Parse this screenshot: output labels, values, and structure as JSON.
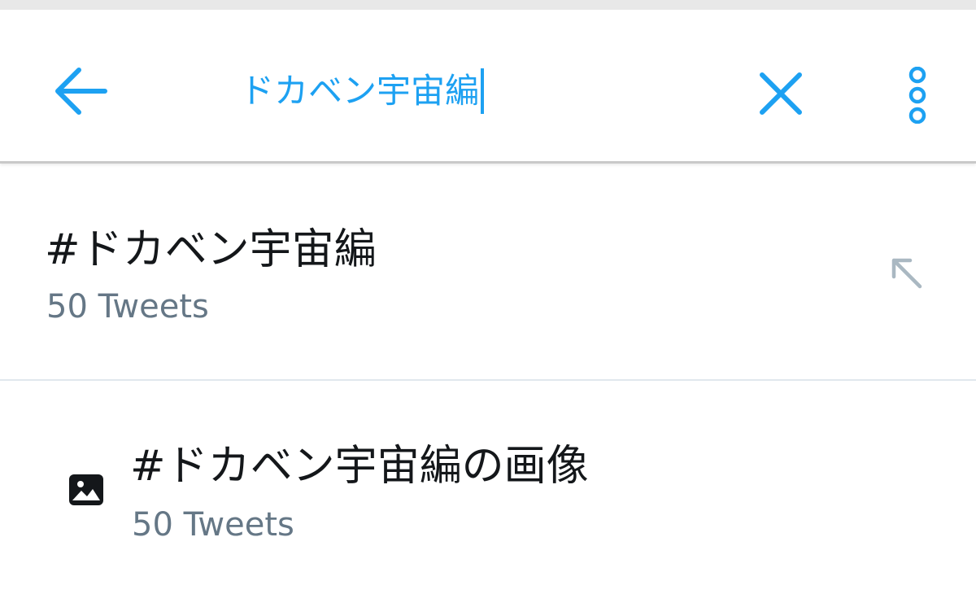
{
  "search": {
    "query": "ドカベン宇宙編"
  },
  "results": [
    {
      "title": "#ドカベン宇宙編",
      "subtitle": "50 Tweets"
    },
    {
      "title": "#ドカベン宇宙編の画像",
      "subtitle": "50 Tweets"
    }
  ],
  "colors": {
    "accent": "#1da1f2",
    "primary_text": "#14171a",
    "secondary_text": "#657786",
    "divider": "#e1e8ed",
    "muted_icon": "#aab8c2"
  },
  "icons": {
    "back": "arrow-left-icon",
    "clear": "close-icon",
    "more": "more-vertical-icon",
    "fill": "arrow-up-left-icon",
    "image": "image-icon"
  }
}
